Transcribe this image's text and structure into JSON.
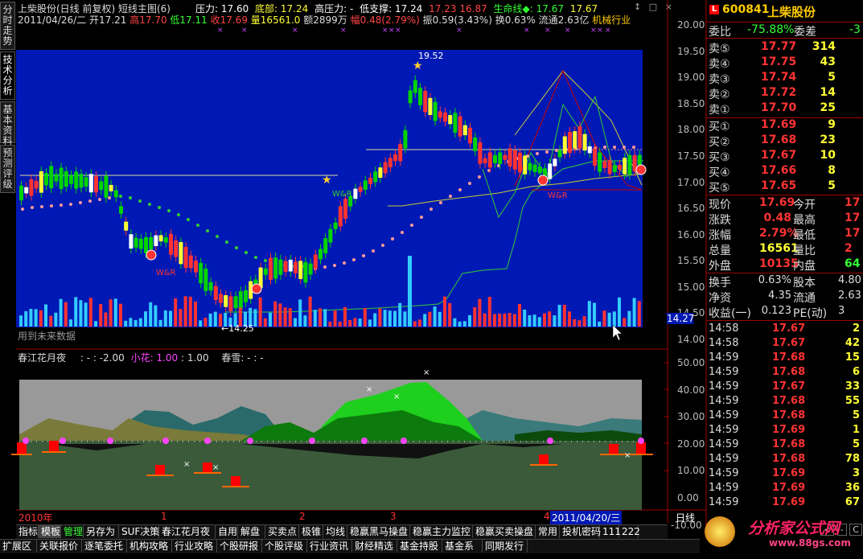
{
  "side_tabs": [
    {
      "label": "分时走势"
    },
    {
      "label": "技术分析"
    },
    {
      "label": "基本资料"
    },
    {
      "label": "预测评级"
    }
  ],
  "top_header": {
    "title": "上柴股份(日线 前复权) 短线主图(6)",
    "pressure": "压力: 17.60",
    "bottom": "底部: 17.24",
    "high_pressure": "高压力: -",
    "low_support": "低支撑: 17.24",
    "v1": "17.23",
    "v2": "16.87",
    "lifeline": "生命线◆: 17.67",
    "lifeline_v2": "17.67",
    "window_btn1": "↕",
    "window_btn2": "□",
    "window_btn3": "×"
  },
  "info_row": {
    "date": "2011/04/26/二",
    "open": "开17.21",
    "high": "高17.70",
    "low": "低17.11",
    "close": "收17.69",
    "volume": "量16561.0",
    "amount": "额2899万",
    "change": "幅0.48(2.79%)",
    "amplitude": "振0.59(3.43%)",
    "turnover": "换0.63%",
    "float": "流通2.63亿",
    "industry": "机械行业"
  },
  "price_axis": [
    "20.00",
    "19.50",
    "19.00",
    "18.50",
    "18.00",
    "17.50",
    "17.00",
    "16.50",
    "16.00",
    "15.50",
    "15.00",
    "14.50",
    "14.00"
  ],
  "price_tag": "14.27",
  "chart_notes": {
    "max_label": "19.52",
    "min_label": "←14.25",
    "wr1": "W&R",
    "wr2": "W&R",
    "wr3": "W&R",
    "future_hint": "用到未来数据"
  },
  "indicator_header": {
    "name": "春江花月夜",
    "p1": ": - : -2.00",
    "p2": "小花: 1.00",
    "p3": ": 1.00",
    "p4": "春雪: - : -"
  },
  "indicator_axis": [
    "50.00",
    "40.00",
    "30.00",
    "20.00",
    "10.00",
    "0.00",
    "-10.00"
  ],
  "date_axis": {
    "year": "2010年",
    "m1": "1",
    "m2": "2",
    "m3": "3",
    "m4": "4",
    "cursor_date": "2011/04/20/三",
    "period": "日线"
  },
  "quote": {
    "code": "600841",
    "name": "上柴股份",
    "logo": "L",
    "webi_label": "委比",
    "webi": "-75.88%",
    "weicha_label": "委差",
    "weicha": "-3",
    "asks": [
      {
        "label": "卖⑤",
        "price": "17.77",
        "vol": "314"
      },
      {
        "label": "卖④",
        "price": "17.75",
        "vol": "43"
      },
      {
        "label": "卖③",
        "price": "17.74",
        "vol": "5"
      },
      {
        "label": "卖②",
        "price": "17.72",
        "vol": "14"
      },
      {
        "label": "卖①",
        "price": "17.70",
        "vol": "25"
      }
    ],
    "bids": [
      {
        "label": "买①",
        "price": "17.69",
        "vol": "9"
      },
      {
        "label": "买②",
        "price": "17.68",
        "vol": "23"
      },
      {
        "label": "买③",
        "price": "17.67",
        "vol": "10"
      },
      {
        "label": "买④",
        "price": "17.66",
        "vol": "8"
      },
      {
        "label": "买⑤",
        "price": "17.65",
        "vol": "5"
      }
    ],
    "stats": [
      {
        "l1": "现价",
        "v1": "17.69",
        "l2": "今开",
        "v2": "17"
      },
      {
        "l1": "涨跌",
        "v1": "0.48",
        "l2": "最高",
        "v2": "17"
      },
      {
        "l1": "涨幅",
        "v1": "2.79%",
        "l2": "最低",
        "v2": "17"
      },
      {
        "l1": "总量",
        "v1": "16561",
        "l2": "量比",
        "v2": "2"
      },
      {
        "l1": "外盘",
        "v1": "10135",
        "l2": "内盘",
        "v2": "64"
      }
    ],
    "fund": [
      {
        "l1": "换手",
        "v1": "0.63%",
        "l2": "股本",
        "v2": "4.80"
      },
      {
        "l1": "净资",
        "v1": "4.35",
        "l2": "流通",
        "v2": "2.63"
      },
      {
        "l1": "收益(一)",
        "v1": "0.123",
        "l2": "PE(动)",
        "v2": "3"
      }
    ],
    "ticks": [
      {
        "t": "14:58",
        "p": "17.67",
        "v": "2"
      },
      {
        "t": "14:58",
        "p": "17.67",
        "v": "42"
      },
      {
        "t": "14:59",
        "p": "17.68",
        "v": "15"
      },
      {
        "t": "14:59",
        "p": "17.68",
        "v": "6"
      },
      {
        "t": "14:59",
        "p": "17.67",
        "v": "33"
      },
      {
        "t": "14:59",
        "p": "17.68",
        "v": "55"
      },
      {
        "t": "14:59",
        "p": "17.68",
        "v": "5"
      },
      {
        "t": "14:59",
        "p": "17.69",
        "v": "1"
      },
      {
        "t": "14:59",
        "p": "17.68",
        "v": "5"
      },
      {
        "t": "14:59",
        "p": "17.68",
        "v": "78"
      },
      {
        "t": "14:59",
        "p": "17.69",
        "v": "3"
      },
      {
        "t": "14:59",
        "p": "17.69",
        "v": "36"
      },
      {
        "t": "14:59",
        "p": "17.69",
        "v": "67"
      }
    ]
  },
  "bottom_tabs1": [
    "指标",
    "模板",
    "管理",
    "另存为",
    "SUF决策",
    "春江花月夜",
    "自用",
    "解盘",
    "买卖点",
    "极锥",
    "均线",
    "稳赢黑马操盘",
    "稳赢主力监控",
    "稳赢买卖操盘",
    "常用",
    "投机密码",
    "111",
    "222"
  ],
  "bottom_tabs2": [
    "扩展区",
    "关联报价",
    "逐笔委托",
    "机构攻略",
    "行业攻略",
    "个股研报",
    "个股评级",
    "行业资讯",
    "财经精选",
    "基金持股",
    "基金系",
    "同期发行"
  ],
  "nav_buttons": [
    "<",
    "-",
    "C"
  ],
  "watermark": "分析家公式网",
  "watermark_url": "www.88gs.com",
  "colors": {
    "up": "#ff3232",
    "down": "#00d400",
    "chart_bg": "#0019b4",
    "mountain_green": "#1ecf1e",
    "ground": "#3a5a3a"
  }
}
